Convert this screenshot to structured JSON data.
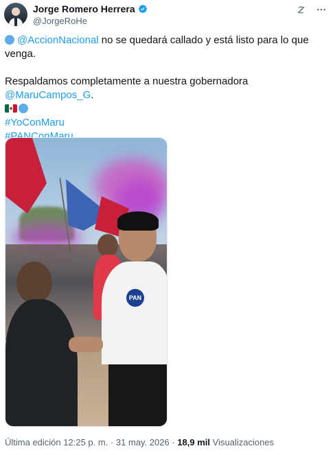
{
  "author": {
    "display_name": "Jorge Romero Herrera",
    "handle": "@JorgeRoHe",
    "verified": true,
    "verified_color": "#1d9bf0"
  },
  "header_icons": [
    "grok-icon",
    "more-icon"
  ],
  "tweet": {
    "line1_mention": "@AccionNacional",
    "line1_rest": " no se quedará callado y está listo para lo que venga.",
    "line2_text": "Respaldamos completamente a nuestra gobernadora ",
    "line2_mention": "@MaruCampos_G",
    "line2_end": ".",
    "hashtag1": "#YoConMaru",
    "hashtag2": "#PANConMaru",
    "emojis": [
      "blue-circle",
      "mexico-flag",
      "blue-circle"
    ]
  },
  "media": {
    "type": "photo",
    "logo_text": "PAN"
  },
  "footer": {
    "edited_label": "Última edición",
    "time": "12:25 p. m.",
    "separator": "·",
    "date": "31 may. 2026",
    "views_count": "18,9 mil",
    "views_label": "Visualizaciones"
  },
  "colors": {
    "link": "#1d9bf0",
    "text": "#0f1419",
    "secondary": "#536471"
  }
}
